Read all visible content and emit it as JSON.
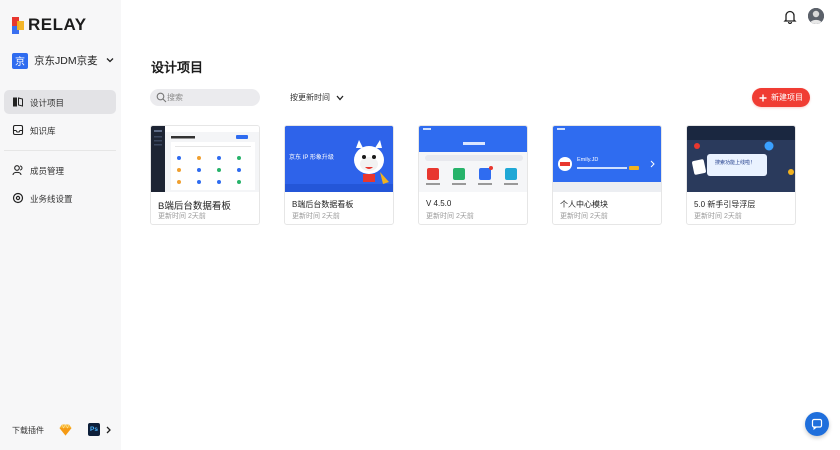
{
  "app": {
    "logo_text": "RELAY"
  },
  "sidebar": {
    "team": {
      "badge": "京",
      "name": "京东JDM京麦"
    },
    "items": [
      {
        "label": "设计项目",
        "icon": "project-icon",
        "active": true
      },
      {
        "label": "知识库",
        "icon": "inbox-icon",
        "active": false
      },
      {
        "label": "成员管理",
        "icon": "members-icon",
        "active": false
      },
      {
        "label": "业务线设置",
        "icon": "settings-icon",
        "active": false
      }
    ],
    "footer": {
      "download_label": "下载插件",
      "ps_label": "Ps"
    }
  },
  "main": {
    "title": "设计项目",
    "search_placeholder": "搜索",
    "sort_label": "按更新时间",
    "new_button_label": "新建项目",
    "cards": [
      {
        "title": "B端后台数据看板",
        "meta": "更新时间 2天前"
      },
      {
        "title": "B端后台数据看板",
        "meta": "更新时间 2天前",
        "thumb_text": "京东 IP 形象升级"
      },
      {
        "title": "V 4.5.0",
        "meta": "更新时间 2天前"
      },
      {
        "title": "个人中心模块",
        "meta": "更新时间 2天前",
        "thumb_text": "Emily.JD"
      },
      {
        "title": "5.0 新手引导浮层",
        "meta": "更新时间 2天前",
        "thumb_text": "搜索功能上线啦！"
      }
    ]
  },
  "colors": {
    "accent": "#f03c33",
    "brand_blue": "#2f6cf0",
    "sidebar_bg": "#f7f7f8"
  }
}
